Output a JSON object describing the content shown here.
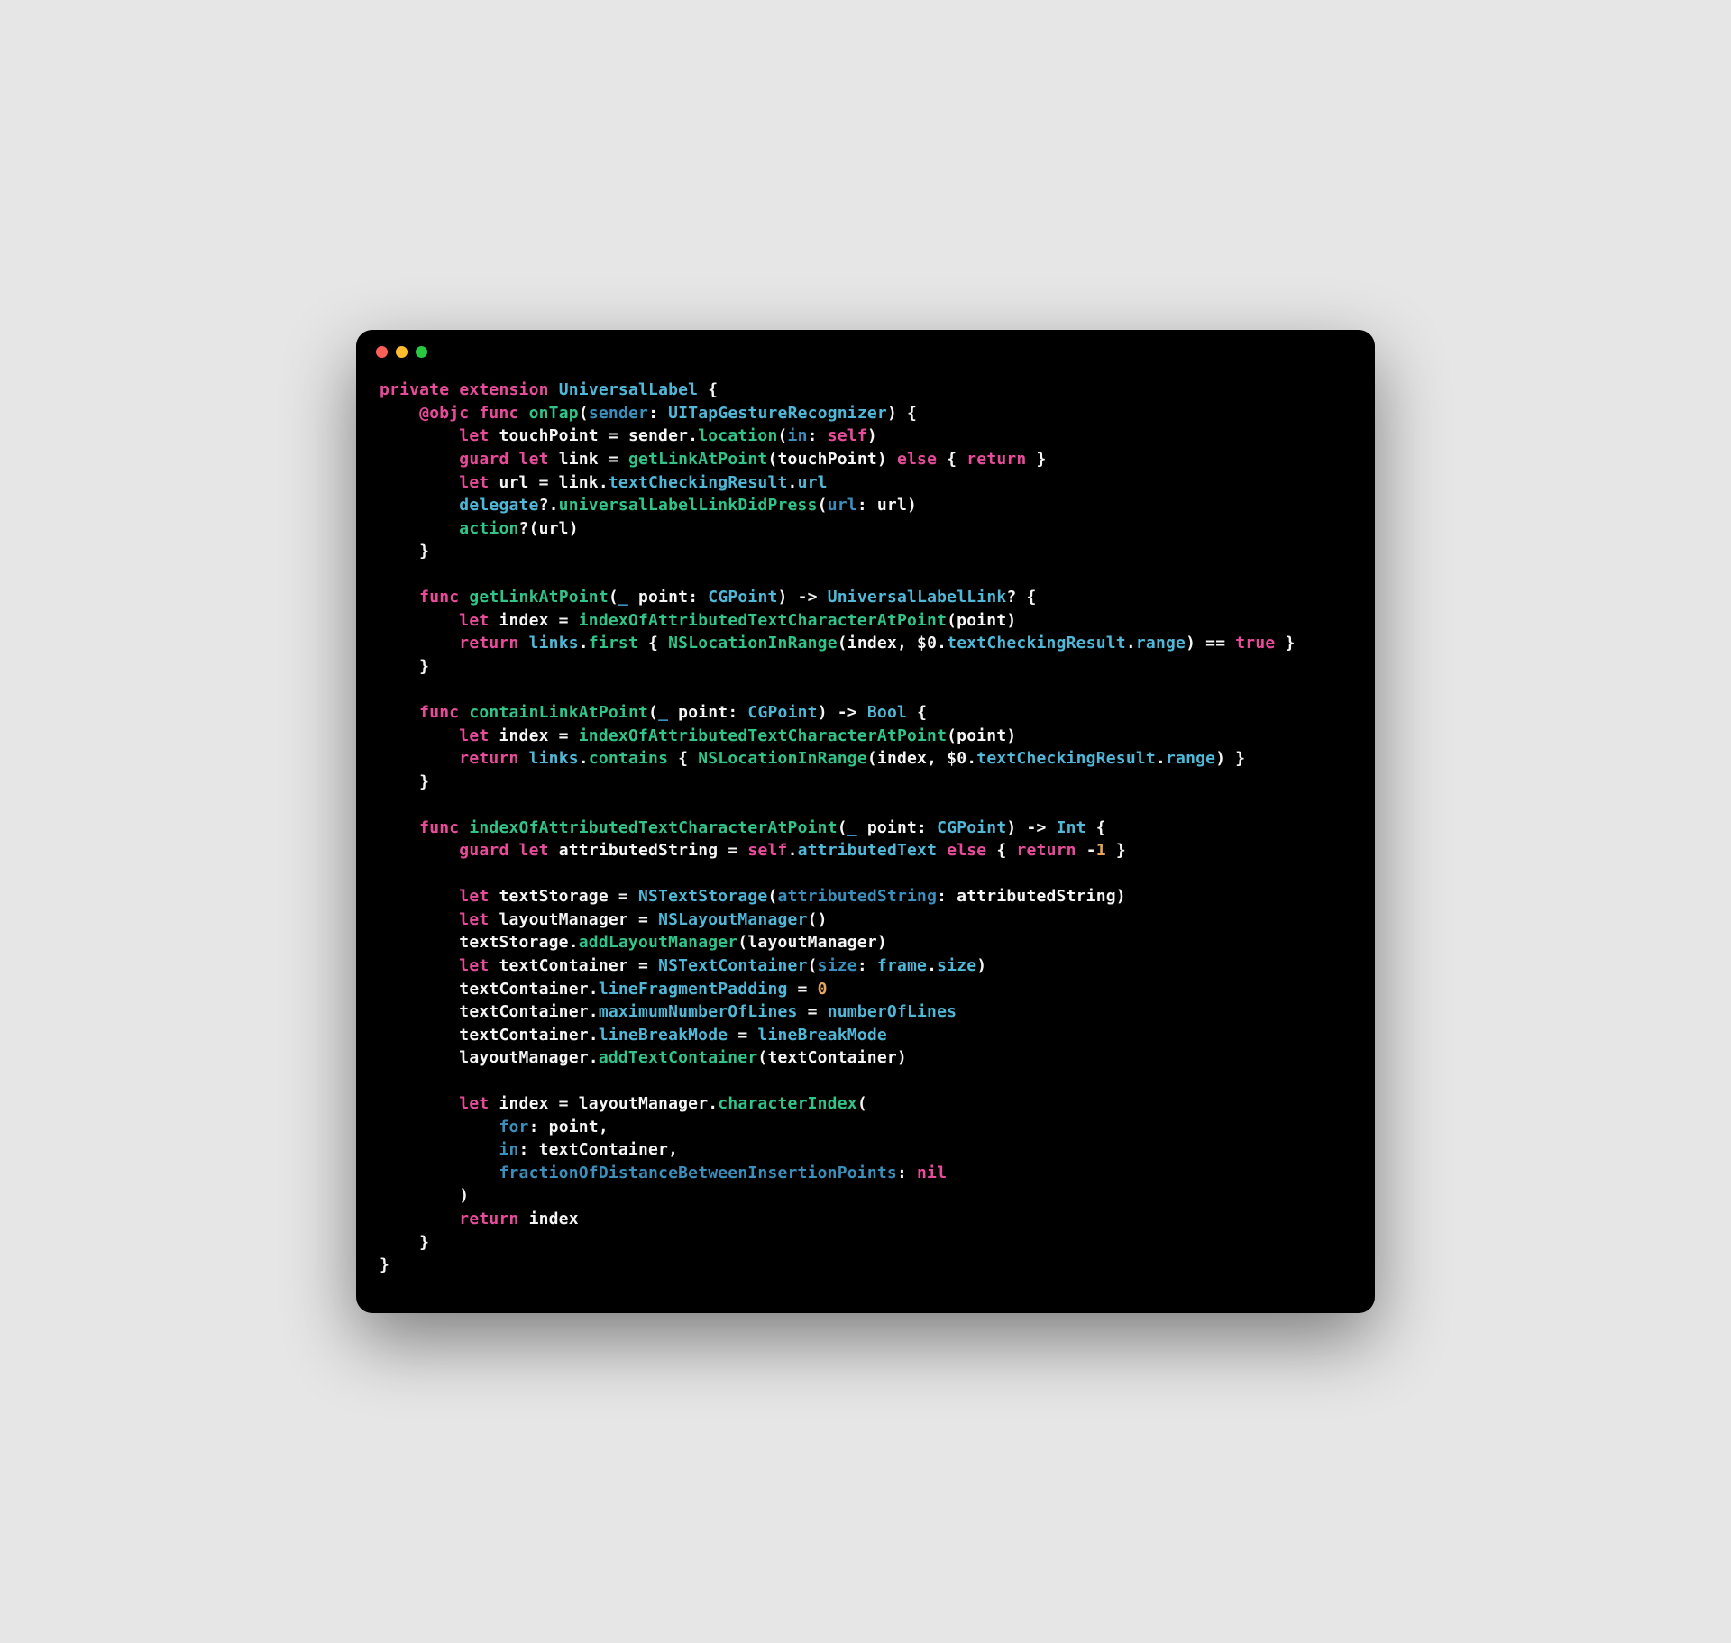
{
  "code": {
    "tokens": [
      [
        [
          "kw",
          "private"
        ],
        [
          "pl",
          " "
        ],
        [
          "kw",
          "extension"
        ],
        [
          "pl",
          " "
        ],
        [
          "typ",
          "UniversalLabel"
        ],
        [
          "pl",
          " {"
        ]
      ],
      [
        [
          "pl",
          "    "
        ],
        [
          "attr",
          "@objc"
        ],
        [
          "pl",
          " "
        ],
        [
          "kw",
          "func"
        ],
        [
          "pl",
          " "
        ],
        [
          "fn",
          "onTap"
        ],
        [
          "pl",
          "("
        ],
        [
          "param",
          "sender"
        ],
        [
          "pl",
          ": "
        ],
        [
          "typ",
          "UITapGestureRecognizer"
        ],
        [
          "pl",
          ") {"
        ]
      ],
      [
        [
          "pl",
          "        "
        ],
        [
          "kw",
          "let"
        ],
        [
          "pl",
          " touchPoint = sender."
        ],
        [
          "fn",
          "location"
        ],
        [
          "pl",
          "("
        ],
        [
          "param",
          "in"
        ],
        [
          "pl",
          ": "
        ],
        [
          "kw",
          "self"
        ],
        [
          "pl",
          ")"
        ]
      ],
      [
        [
          "pl",
          "        "
        ],
        [
          "kw",
          "guard"
        ],
        [
          "pl",
          " "
        ],
        [
          "kw",
          "let"
        ],
        [
          "pl",
          " link = "
        ],
        [
          "fn",
          "getLinkAtPoint"
        ],
        [
          "pl",
          "(touchPoint) "
        ],
        [
          "kw",
          "else"
        ],
        [
          "pl",
          " { "
        ],
        [
          "kw",
          "return"
        ],
        [
          "pl",
          " }"
        ]
      ],
      [
        [
          "pl",
          "        "
        ],
        [
          "kw",
          "let"
        ],
        [
          "pl",
          " url = link."
        ],
        [
          "typ",
          "textCheckingResult"
        ],
        [
          "pl",
          "."
        ],
        [
          "typ",
          "url"
        ]
      ],
      [
        [
          "pl",
          "        "
        ],
        [
          "typ",
          "delegate"
        ],
        [
          "pl",
          "?."
        ],
        [
          "fn",
          "universalLabelLinkDidPress"
        ],
        [
          "pl",
          "("
        ],
        [
          "param",
          "url"
        ],
        [
          "pl",
          ": url)"
        ]
      ],
      [
        [
          "pl",
          "        "
        ],
        [
          "fn",
          "action"
        ],
        [
          "pl",
          "?(url)"
        ]
      ],
      [
        [
          "pl",
          "    }"
        ]
      ],
      [
        [
          "pl",
          ""
        ]
      ],
      [
        [
          "pl",
          "    "
        ],
        [
          "kw",
          "func"
        ],
        [
          "pl",
          " "
        ],
        [
          "fn",
          "getLinkAtPoint"
        ],
        [
          "pl",
          "("
        ],
        [
          "param",
          "_"
        ],
        [
          "pl",
          " point: "
        ],
        [
          "typ",
          "CGPoint"
        ],
        [
          "pl",
          ") -> "
        ],
        [
          "typ",
          "UniversalLabelLink"
        ],
        [
          "pl",
          "? {"
        ]
      ],
      [
        [
          "pl",
          "        "
        ],
        [
          "kw",
          "let"
        ],
        [
          "pl",
          " index = "
        ],
        [
          "fn",
          "indexOfAttributedTextCharacterAtPoint"
        ],
        [
          "pl",
          "(point)"
        ]
      ],
      [
        [
          "pl",
          "        "
        ],
        [
          "kw",
          "return"
        ],
        [
          "pl",
          " "
        ],
        [
          "typ",
          "links"
        ],
        [
          "pl",
          "."
        ],
        [
          "fn",
          "first"
        ],
        [
          "pl",
          " { "
        ],
        [
          "fn",
          "NSLocationInRange"
        ],
        [
          "pl",
          "(index, $0."
        ],
        [
          "typ",
          "textCheckingResult"
        ],
        [
          "pl",
          "."
        ],
        [
          "typ",
          "range"
        ],
        [
          "pl",
          ") == "
        ],
        [
          "kw",
          "true"
        ],
        [
          "pl",
          " }"
        ]
      ],
      [
        [
          "pl",
          "    }"
        ]
      ],
      [
        [
          "pl",
          ""
        ]
      ],
      [
        [
          "pl",
          "    "
        ],
        [
          "kw",
          "func"
        ],
        [
          "pl",
          " "
        ],
        [
          "fn",
          "containLinkAtPoint"
        ],
        [
          "pl",
          "("
        ],
        [
          "param",
          "_"
        ],
        [
          "pl",
          " point: "
        ],
        [
          "typ",
          "CGPoint"
        ],
        [
          "pl",
          ") -> "
        ],
        [
          "typ",
          "Bool"
        ],
        [
          "pl",
          " {"
        ]
      ],
      [
        [
          "pl",
          "        "
        ],
        [
          "kw",
          "let"
        ],
        [
          "pl",
          " index = "
        ],
        [
          "fn",
          "indexOfAttributedTextCharacterAtPoint"
        ],
        [
          "pl",
          "(point)"
        ]
      ],
      [
        [
          "pl",
          "        "
        ],
        [
          "kw",
          "return"
        ],
        [
          "pl",
          " "
        ],
        [
          "typ",
          "links"
        ],
        [
          "pl",
          "."
        ],
        [
          "fn",
          "contains"
        ],
        [
          "pl",
          " { "
        ],
        [
          "fn",
          "NSLocationInRange"
        ],
        [
          "pl",
          "(index, $0."
        ],
        [
          "typ",
          "textCheckingResult"
        ],
        [
          "pl",
          "."
        ],
        [
          "typ",
          "range"
        ],
        [
          "pl",
          ") }"
        ]
      ],
      [
        [
          "pl",
          "    }"
        ]
      ],
      [
        [
          "pl",
          ""
        ]
      ],
      [
        [
          "pl",
          "    "
        ],
        [
          "kw",
          "func"
        ],
        [
          "pl",
          " "
        ],
        [
          "fn",
          "indexOfAttributedTextCharacterAtPoint"
        ],
        [
          "pl",
          "("
        ],
        [
          "param",
          "_"
        ],
        [
          "pl",
          " point: "
        ],
        [
          "typ",
          "CGPoint"
        ],
        [
          "pl",
          ") -> "
        ],
        [
          "typ",
          "Int"
        ],
        [
          "pl",
          " {"
        ]
      ],
      [
        [
          "pl",
          "        "
        ],
        [
          "kw",
          "guard"
        ],
        [
          "pl",
          " "
        ],
        [
          "kw",
          "let"
        ],
        [
          "pl",
          " attributedString = "
        ],
        [
          "kw",
          "self"
        ],
        [
          "pl",
          "."
        ],
        [
          "typ",
          "attributedText"
        ],
        [
          "pl",
          " "
        ],
        [
          "kw",
          "else"
        ],
        [
          "pl",
          " { "
        ],
        [
          "kw",
          "return"
        ],
        [
          "pl",
          " -"
        ],
        [
          "lit",
          "1"
        ],
        [
          "pl",
          " }"
        ]
      ],
      [
        [
          "pl",
          ""
        ]
      ],
      [
        [
          "pl",
          "        "
        ],
        [
          "kw",
          "let"
        ],
        [
          "pl",
          " textStorage = "
        ],
        [
          "typ",
          "NSTextStorage"
        ],
        [
          "pl",
          "("
        ],
        [
          "param",
          "attributedString"
        ],
        [
          "pl",
          ": attributedString)"
        ]
      ],
      [
        [
          "pl",
          "        "
        ],
        [
          "kw",
          "let"
        ],
        [
          "pl",
          " layoutManager = "
        ],
        [
          "typ",
          "NSLayoutManager"
        ],
        [
          "pl",
          "()"
        ]
      ],
      [
        [
          "pl",
          "        textStorage."
        ],
        [
          "fn",
          "addLayoutManager"
        ],
        [
          "pl",
          "(layoutManager)"
        ]
      ],
      [
        [
          "pl",
          "        "
        ],
        [
          "kw",
          "let"
        ],
        [
          "pl",
          " textContainer = "
        ],
        [
          "typ",
          "NSTextContainer"
        ],
        [
          "pl",
          "("
        ],
        [
          "param",
          "size"
        ],
        [
          "pl",
          ": "
        ],
        [
          "typ",
          "frame"
        ],
        [
          "pl",
          "."
        ],
        [
          "typ",
          "size"
        ],
        [
          "pl",
          ")"
        ]
      ],
      [
        [
          "pl",
          "        textContainer."
        ],
        [
          "typ",
          "lineFragmentPadding"
        ],
        [
          "pl",
          " = "
        ],
        [
          "lit",
          "0"
        ]
      ],
      [
        [
          "pl",
          "        textContainer."
        ],
        [
          "typ",
          "maximumNumberOfLines"
        ],
        [
          "pl",
          " = "
        ],
        [
          "typ",
          "numberOfLines"
        ]
      ],
      [
        [
          "pl",
          "        textContainer."
        ],
        [
          "typ",
          "lineBreakMode"
        ],
        [
          "pl",
          " = "
        ],
        [
          "typ",
          "lineBreakMode"
        ]
      ],
      [
        [
          "pl",
          "        layoutManager."
        ],
        [
          "fn",
          "addTextContainer"
        ],
        [
          "pl",
          "(textContainer)"
        ]
      ],
      [
        [
          "pl",
          ""
        ]
      ],
      [
        [
          "pl",
          "        "
        ],
        [
          "kw",
          "let"
        ],
        [
          "pl",
          " index = layoutManager."
        ],
        [
          "fn",
          "characterIndex"
        ],
        [
          "pl",
          "("
        ]
      ],
      [
        [
          "pl",
          "            "
        ],
        [
          "param",
          "for"
        ],
        [
          "pl",
          ": point,"
        ]
      ],
      [
        [
          "pl",
          "            "
        ],
        [
          "param",
          "in"
        ],
        [
          "pl",
          ": textContainer,"
        ]
      ],
      [
        [
          "pl",
          "            "
        ],
        [
          "param",
          "fractionOfDistanceBetweenInsertionPoints"
        ],
        [
          "pl",
          ": "
        ],
        [
          "kw",
          "nil"
        ]
      ],
      [
        [
          "pl",
          "        )"
        ]
      ],
      [
        [
          "pl",
          "        "
        ],
        [
          "kw",
          "return"
        ],
        [
          "pl",
          " index"
        ]
      ],
      [
        [
          "pl",
          "    }"
        ]
      ],
      [
        [
          "pl",
          "}"
        ]
      ]
    ]
  },
  "window": {
    "traffic_lights": [
      "close",
      "minimize",
      "zoom"
    ]
  }
}
